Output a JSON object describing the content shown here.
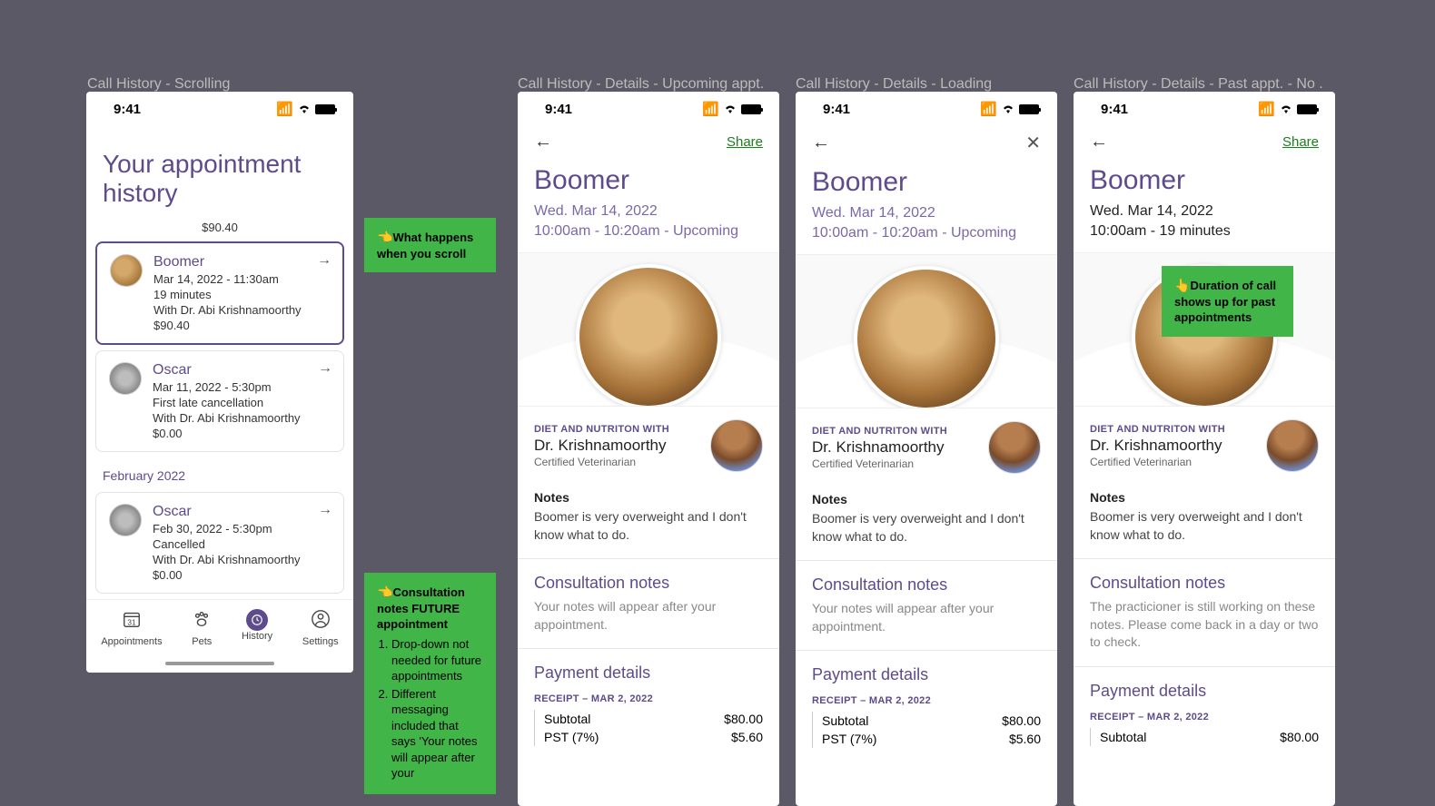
{
  "status_time": "9:41",
  "frames": {
    "s1_label": "Call History - Scrolling",
    "s2_label": "Call History - Details - Upcoming appt.",
    "s3_label": "Call History - Details - Loading",
    "s4_label": "Call History - Details - Past appt. - No ."
  },
  "screen1": {
    "title": "Your appointment history",
    "cut_price": "$90.40",
    "cards": [
      {
        "name": "Boomer",
        "date": "Mar 14, 2022 - 11:30am",
        "duration": "19 minutes",
        "with": "With Dr. Abi Krishnamoorthy",
        "price": "$90.40"
      },
      {
        "name": "Oscar",
        "date": "Mar 11, 2022 - 5:30pm",
        "duration": "First late cancellation",
        "with": "With Dr. Abi Krishnamoorthy",
        "price": "$0.00"
      },
      {
        "name": "Oscar",
        "date": "Feb 30, 2022 - 5:30pm",
        "duration": "Cancelled",
        "with": "With Dr. Abi Krishnamoorthy",
        "price": "$0.00"
      }
    ],
    "month_header": "February 2022",
    "tabs": {
      "appointments": "Appointments",
      "pets": "Pets",
      "history": "History",
      "settings": "Settings"
    }
  },
  "detail_common": {
    "pet_name": "Boomer",
    "date": "Wed. Mar 14, 2022",
    "share": "Share",
    "vet_topic": "DIET AND NUTRITON WITH",
    "vet_name": "Dr. Krishnamoorthy",
    "vet_title": "Certified Veterinarian",
    "notes_label": "Notes",
    "notes_text": "Boomer is very overweight and I don't know what to do.",
    "consult_h": "Consultation notes",
    "payment_h": "Payment details",
    "receipt_label": "RECEIPT – MAR 2, 2022",
    "subtotal_label": "Subtotal",
    "pst_label": "PST (7%)",
    "subtotal": "$80.00",
    "pst": "$5.60"
  },
  "screen2": {
    "time": "10:00am - 10:20am - Upcoming",
    "consult_text": "Your notes will appear after your appointment."
  },
  "screen3": {
    "time": "10:00am - 10:20am - Upcoming",
    "consult_text": "Your notes will appear after your appointment."
  },
  "screen4": {
    "time": "10:00am - 19 minutes",
    "consult_text": "The practicioner is still working on these notes. Please come back in a day or two to check."
  },
  "notes": {
    "n1": "What happens when you scroll",
    "n2_title": "Consultation notes FUTURE appointment",
    "n2_i1": "Drop-down not needed for future appointments",
    "n2_i2": "Different messaging included that says 'Your notes will appear after your",
    "n3": "Duration of call shows up for past appointments"
  }
}
